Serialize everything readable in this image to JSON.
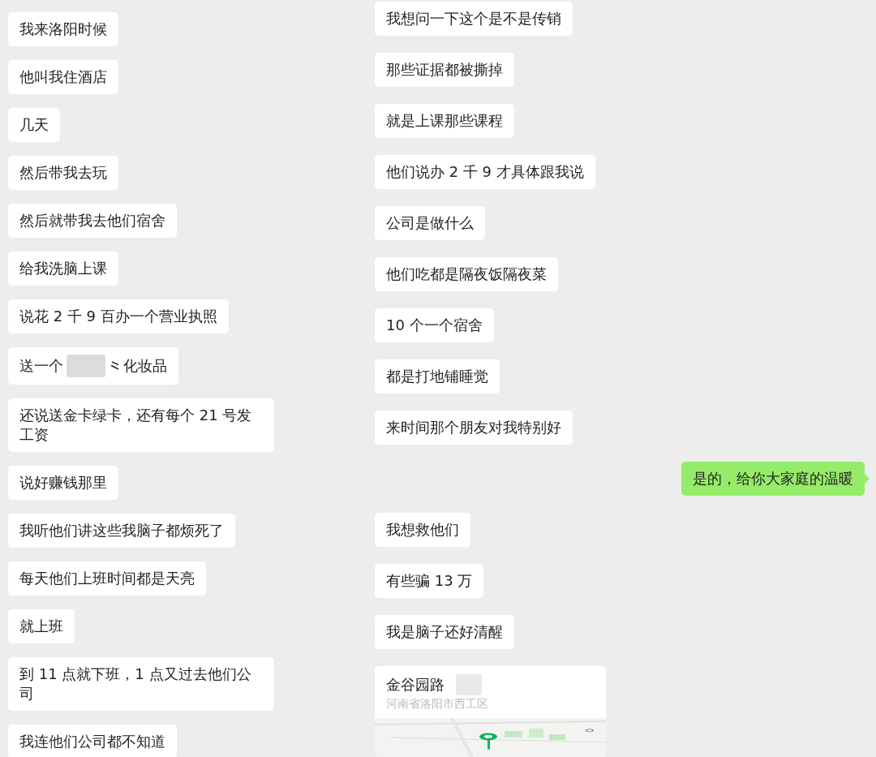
{
  "left_messages": [
    {
      "kind": "text",
      "text": "我来洛阳时候"
    },
    {
      "kind": "text",
      "text": "他叫我住酒店"
    },
    {
      "kind": "text",
      "text": "几天"
    },
    {
      "kind": "text",
      "text": "然后带我去玩"
    },
    {
      "kind": "text",
      "text": "然后就带我去他们宿舍"
    },
    {
      "kind": "text",
      "text": "给我洗脑上课"
    },
    {
      "kind": "text",
      "text": "说花 2 千 9 百办一个营业执照"
    },
    {
      "kind": "redacted",
      "parts": [
        "送一个",
        "⺀化妆品"
      ]
    },
    {
      "kind": "text",
      "text": "还说送金卡绿卡，还有每个 21 号发工资"
    },
    {
      "kind": "text",
      "text": "说好赚钱那里"
    },
    {
      "kind": "text",
      "text": "我听他们讲这些我脑子都烦死了"
    },
    {
      "kind": "text",
      "text": "每天他们上班时间都是天亮"
    },
    {
      "kind": "text",
      "text": "就上班"
    },
    {
      "kind": "text",
      "text": "到 11 点就下班，1 点又过去他们公司"
    },
    {
      "kind": "text",
      "text": "我连他们公司都不知道"
    }
  ],
  "right_messages": [
    {
      "kind": "text",
      "outgoing": false,
      "text": "我想问一下这个是不是传销"
    },
    {
      "kind": "text",
      "outgoing": false,
      "text": "那些证据都被撕掉"
    },
    {
      "kind": "text",
      "outgoing": false,
      "text": "就是上课那些课程"
    },
    {
      "kind": "text",
      "outgoing": false,
      "text": "他们说办 2 千 9 才具体跟我说"
    },
    {
      "kind": "text",
      "outgoing": false,
      "text": "公司是做什么"
    },
    {
      "kind": "text",
      "outgoing": false,
      "text": "他们吃都是隔夜饭隔夜菜"
    },
    {
      "kind": "text",
      "outgoing": false,
      "text": "10 个一个宿舍"
    },
    {
      "kind": "text",
      "outgoing": false,
      "text": "都是打地铺睡觉"
    },
    {
      "kind": "text",
      "outgoing": false,
      "text": "来时间那个朋友对我特别好"
    },
    {
      "kind": "text",
      "outgoing": true,
      "text": "是的，给你大家庭的温暖"
    },
    {
      "kind": "text",
      "outgoing": false,
      "text": "我想救他们"
    },
    {
      "kind": "text",
      "outgoing": false,
      "text": "有些骗 13 万"
    },
    {
      "kind": "text",
      "outgoing": false,
      "text": "我是脑子还好清醒"
    },
    {
      "kind": "location",
      "outgoing": false,
      "title": "金谷园路",
      "address": "河南省洛阳市西工区"
    }
  ]
}
